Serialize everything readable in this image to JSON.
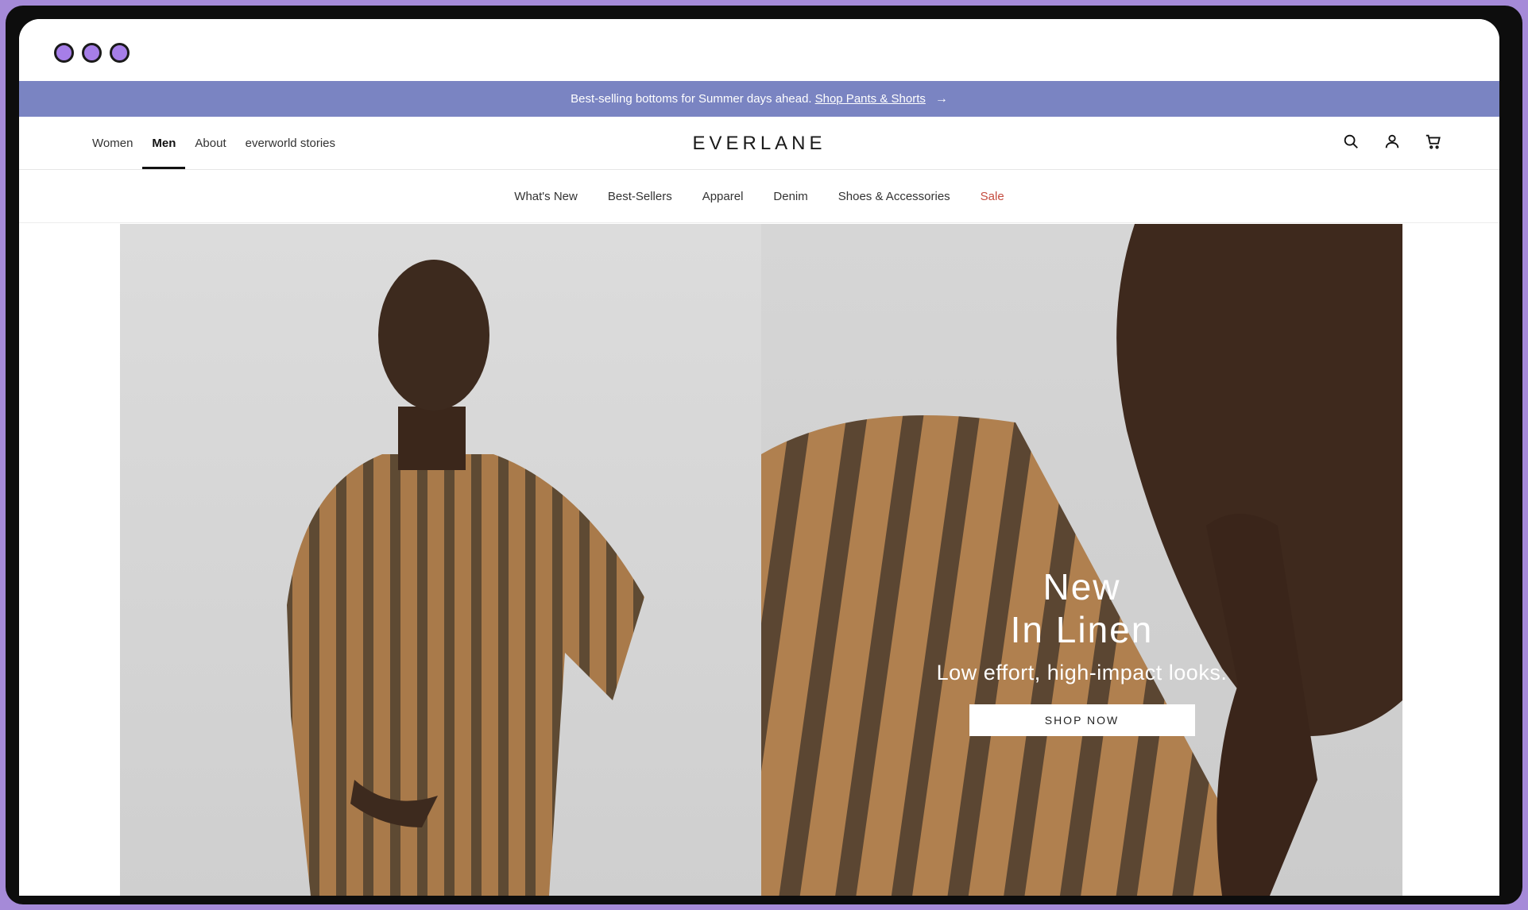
{
  "announcement": {
    "lead": "Best-selling bottoms for Summer days ahead.",
    "link": "Shop Pants & Shorts",
    "arrow_icon": "arrow-right-icon"
  },
  "header": {
    "nav": [
      "Women",
      "Men",
      "About",
      "everworld stories"
    ],
    "active": "Men",
    "logo": "EVERLANE",
    "icons": [
      "search-icon",
      "account-icon",
      "cart-icon"
    ]
  },
  "subnav": [
    "What's New",
    "Best-Sellers",
    "Apparel",
    "Denim",
    "Shoes & Accessories",
    "Sale"
  ],
  "hero": {
    "title_line1": "New",
    "title_line2": "In Linen",
    "subtitle": "Low effort, high-impact looks.",
    "cta": "SHOP NOW"
  },
  "colors": {
    "announcement_bg": "#7a84c2",
    "sale": "#c44b3e",
    "frame": "#a58ad8"
  }
}
